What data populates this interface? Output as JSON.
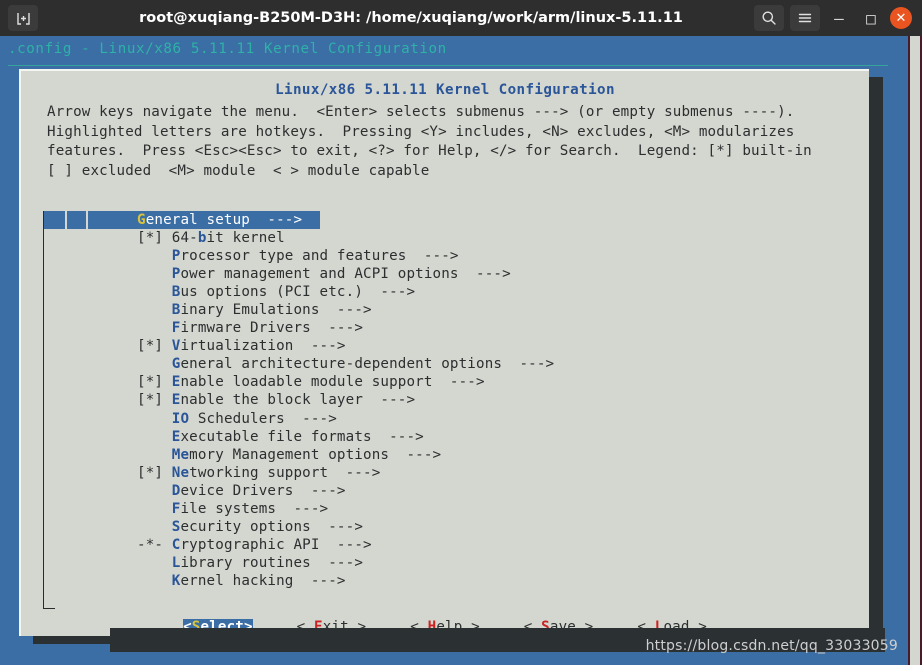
{
  "window": {
    "title": "root@xuqiang-B250M-D3H: /home/xuqiang/work/arm/linux-5.11.11",
    "new_tab_icon": "new-tab-icon",
    "search_icon": "search-icon",
    "menu_icon": "hamburger-menu-icon",
    "minimize_label": "—",
    "maximize_label": "□",
    "close_label": "✕",
    "titlebar_bg": "#2e2e2e",
    "close_bg": "#e95420"
  },
  "terminal": {
    "bg": "#3a6ea5",
    "menuconfig_header": ".config - Linux/x86 5.11.11 Kernel Configuration",
    "header_color": "#2fb1a8"
  },
  "dialog": {
    "bg": "#d4d7cf",
    "title": "Linux/x86 5.11.11 Kernel Configuration",
    "title_color": "#2a5599",
    "help_text": "Arrow keys navigate the menu.  <Enter> selects submenus ---> (or empty submenus ----).\nHighlighted letters are hotkeys.  Pressing <Y> includes, <N> excludes, <M> modularizes\nfeatures.  Press <Esc><Esc> to exit, <?> for Help, </> for Search.  Legend: [*] built-in\n[ ] excluded  <M> module  < > module capable"
  },
  "menu": {
    "items": [
      {
        "flag": "",
        "hot": "G",
        "pre": "",
        "post": "eneral setup",
        "arrow": "  --->",
        "selected": true
      },
      {
        "flag": "[*]",
        "hot": "b",
        "pre": "64-",
        "post": "it kernel",
        "arrow": "",
        "selected": false
      },
      {
        "flag": "",
        "hot": "P",
        "pre": "",
        "post": "rocessor type and features",
        "arrow": "  --->",
        "selected": false
      },
      {
        "flag": "",
        "hot": "P",
        "pre": "",
        "post": "ower management and ACPI options",
        "arrow": "  --->",
        "selected": false
      },
      {
        "flag": "",
        "hot": "B",
        "pre": "",
        "post": "us options (PCI etc.)",
        "arrow": "  --->",
        "selected": false
      },
      {
        "flag": "",
        "hot": "B",
        "pre": "",
        "post": "inary Emulations",
        "arrow": "  --->",
        "selected": false
      },
      {
        "flag": "",
        "hot": "F",
        "pre": "",
        "post": "irmware Drivers",
        "arrow": "  --->",
        "selected": false
      },
      {
        "flag": "[*]",
        "hot": "V",
        "pre": "",
        "post": "irtualization",
        "arrow": "  --->",
        "selected": false
      },
      {
        "flag": "",
        "hot": "G",
        "pre": "",
        "post": "eneral architecture-dependent options",
        "arrow": "  --->",
        "selected": false
      },
      {
        "flag": "[*]",
        "hot": "E",
        "pre": "",
        "post": "nable loadable module support",
        "arrow": "  --->",
        "selected": false
      },
      {
        "flag": "[*]",
        "hot": "E",
        "pre": "",
        "post": "nable the block layer",
        "arrow": "  --->",
        "selected": false
      },
      {
        "flag": "",
        "hot": "IO",
        "pre": "",
        "post": " Schedulers",
        "arrow": "  --->",
        "selected": false
      },
      {
        "flag": "",
        "hot": "E",
        "pre": "",
        "post": "xecutable file formats",
        "arrow": "  --->",
        "selected": false
      },
      {
        "flag": "",
        "hot": "Me",
        "pre": "",
        "post": "mory Management options",
        "arrow": "  --->",
        "selected": false
      },
      {
        "flag": "[*]",
        "hot": "Ne",
        "pre": "",
        "post": "tworking support",
        "arrow": "  --->",
        "selected": false
      },
      {
        "flag": "",
        "hot": "D",
        "pre": "",
        "post": "evice Drivers",
        "arrow": "  --->",
        "selected": false
      },
      {
        "flag": "",
        "hot": "F",
        "pre": "",
        "post": "ile systems",
        "arrow": "  --->",
        "selected": false
      },
      {
        "flag": "",
        "hot": "S",
        "pre": "",
        "post": "ecurity options",
        "arrow": "  --->",
        "selected": false
      },
      {
        "flag": "-*-",
        "hot": "C",
        "pre": "",
        "post": "ryptographic API",
        "arrow": "  --->",
        "selected": false
      },
      {
        "flag": "",
        "hot": "L",
        "pre": "",
        "post": "ibrary routines",
        "arrow": "  --->",
        "selected": false
      },
      {
        "flag": "",
        "hot": "K",
        "pre": "",
        "post": "ernel hacking",
        "arrow": "  --->",
        "selected": false
      }
    ],
    "hotkey_color": "#2a5599",
    "selected_bg": "#3a6ea5",
    "selected_hotkey_color": "#d9c33a"
  },
  "buttons": [
    {
      "left": "<",
      "hot": "S",
      "rest": "elect",
      "right": ">",
      "active": true
    },
    {
      "left": "< ",
      "hot": "E",
      "rest": "xit",
      "right": " >",
      "active": false
    },
    {
      "left": "< ",
      "hot": "H",
      "rest": "elp",
      "right": " >",
      "active": false
    },
    {
      "left": "< ",
      "hot": "S",
      "rest": "ave",
      "right": " >",
      "active": false
    },
    {
      "left": "< ",
      "hot": "L",
      "rest": "oad",
      "right": " >",
      "active": false
    }
  ],
  "button_hotkey_color": "#cc2222",
  "watermark": "https://blog.csdn.net/qq_33033059"
}
